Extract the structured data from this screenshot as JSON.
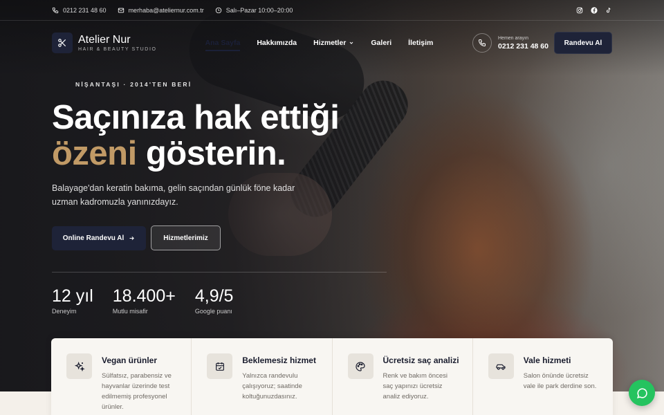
{
  "topbar": {
    "phone": "0212 231 48 60",
    "email": "merhaba@ateliernur.com.tr",
    "hours": "Salı–Pazar 10:00–20:00",
    "socials": [
      "instagram-icon",
      "facebook-icon",
      "tiktok-icon"
    ]
  },
  "brand": {
    "name": "Atelier Nur",
    "tagline": "HAIR & BEAUTY STUDIO",
    "logo_icon": "scissors-icon"
  },
  "nav": {
    "items": [
      {
        "label": "Ana Sayfa",
        "active": true
      },
      {
        "label": "Hakkımızda"
      },
      {
        "label": "Hizmetler",
        "dropdown": true
      },
      {
        "label": "Galeri"
      },
      {
        "label": "İletişim"
      }
    ]
  },
  "call": {
    "label": "Hemen arayın",
    "number": "0212 231 48 60"
  },
  "header_cta": "Randevu Al",
  "hero": {
    "eyebrow": "NİŞANTAŞI · 2014'TEN BERİ",
    "headline_line1": "Saçınıza hak ettiği",
    "headline_accent": "özeni",
    "headline_rest": " gösterin.",
    "subtext": "Balayage'dan keratin bakıma, gelin saçından günlük föne kadar uzman kadromuzla yanınızdayız.",
    "primary_cta": "Online Randevu Al",
    "secondary_cta": "Hizmetlerimiz"
  },
  "stats": [
    {
      "value": "12 yıl",
      "label": "Deneyim"
    },
    {
      "value": "18.400+",
      "label": "Mutlu misafir"
    },
    {
      "value": "4,9/5",
      "label": "Google puanı"
    }
  ],
  "features": [
    {
      "icon": "sparkles-icon",
      "title": "Vegan ürünler",
      "desc": "Sülfatsız, parabensiz ve hayvanlar üzerinde test edilmemiş profesyonel ürünler."
    },
    {
      "icon": "calendar-check-icon",
      "title": "Beklemesiz hizmet",
      "desc": "Yalnızca randevulu çalışıyoruz; saatinde koltuğunuzdasınız."
    },
    {
      "icon": "palette-icon",
      "title": "Ücretsiz saç analizi",
      "desc": "Renk ve bakım öncesi saç yapınızı ücretsiz analiz ediyoruz."
    },
    {
      "icon": "car-icon",
      "title": "Vale hizmeti",
      "desc": "Salon önünde ücretsiz vale ile park derdine son."
    }
  ],
  "colors": {
    "navy": "#1e2338",
    "accent_gold": "#c19a66",
    "whatsapp": "#25c35f",
    "card_bg": "#f8f6f2"
  },
  "fab_icon": "whatsapp-icon"
}
